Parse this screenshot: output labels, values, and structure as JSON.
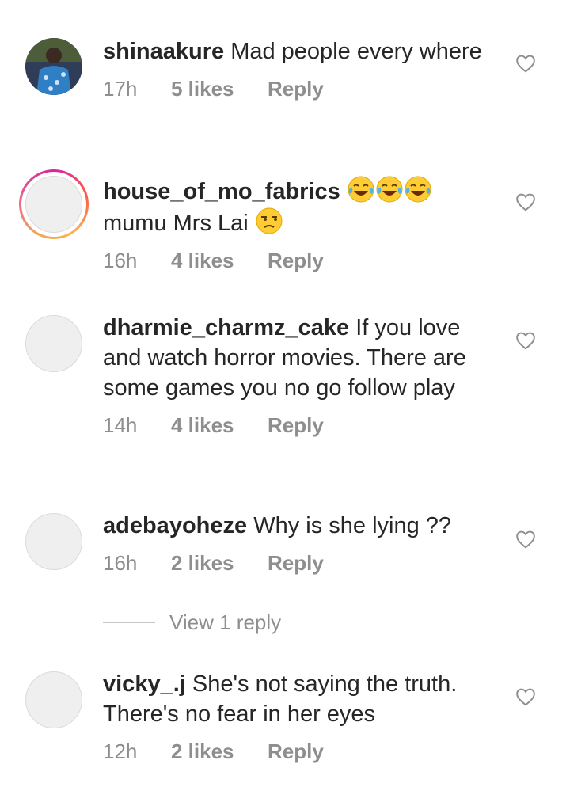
{
  "comments": [
    {
      "username": "shinaakure",
      "text": "Mad people every where",
      "time": "17h",
      "likes": "5 likes",
      "reply": "Reply"
    },
    {
      "username": "house_of_mo_fabrics",
      "text": "mumu Mrs Lai",
      "emojis_after_username": [
        "face-with-tears-of-joy",
        "face-with-tears-of-joy",
        "face-with-tears-of-joy"
      ],
      "emoji_after_text": "unamused-face",
      "time": "16h",
      "likes": "4 likes",
      "reply": "Reply"
    },
    {
      "username": "dharmie_charmz_cake",
      "text": "If you love and watch horror movies. There are some games you no go follow play",
      "time": "14h",
      "likes": "4 likes",
      "reply": "Reply"
    },
    {
      "username": "adebayoheze",
      "text": "Why is she lying ??",
      "time": "16h",
      "likes": "2 likes",
      "reply": "Reply"
    },
    {
      "username": "vicky_.j",
      "text": "She's not saying the truth. There's no fear in her eyes",
      "time": "12h",
      "likes": "2 likes",
      "reply": "Reply"
    }
  ],
  "view_replies": {
    "label": "View 1 reply"
  },
  "colors": {
    "text_primary": "#262626",
    "text_secondary": "#8e8e8e",
    "avatar_placeholder": "#efefef",
    "story_ring_start": "#d6249f",
    "story_ring_end": "#fdb24b"
  },
  "icons": {
    "like": "heart-outline-icon"
  }
}
